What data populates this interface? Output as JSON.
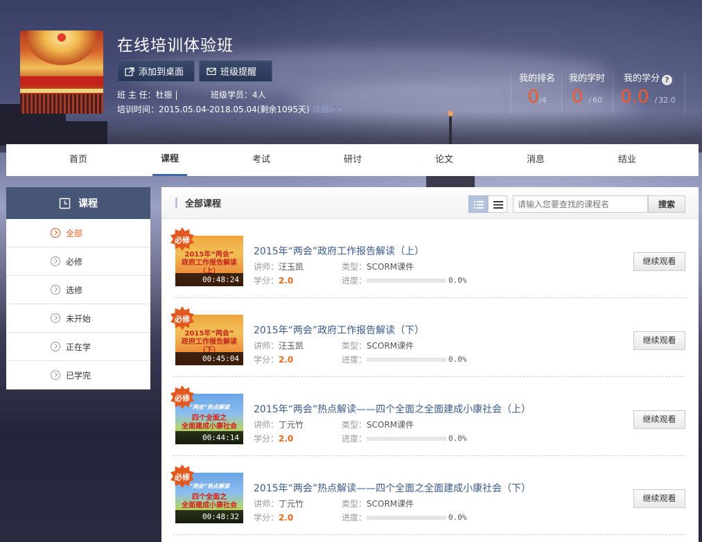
{
  "header": {
    "title": "在线培训体验班",
    "add_desktop_label": "添加到桌面",
    "reminder_label": "班级提醒",
    "teacher_line": "班 主 任：杜振 |",
    "members_line": "班级学员：4人",
    "time_line": "培训时间：2015.05.04-2018.05.04(剩余1095天)",
    "details_link": "详细>>"
  },
  "stats": {
    "rank": {
      "label": "我的排名",
      "value": "0",
      "total": "/4"
    },
    "hours": {
      "label": "我的学时",
      "value": "0",
      "sep": "/",
      "total": "60"
    },
    "credits": {
      "label": "我的学分",
      "value": "0.0",
      "sep": "/",
      "total": "32.0",
      "help": "?"
    }
  },
  "nav": {
    "items": [
      "首页",
      "课程",
      "考试",
      "研讨",
      "论文",
      "消息",
      "结业"
    ],
    "active": "课程"
  },
  "sidebar": {
    "title": "课程",
    "items": [
      {
        "label": "全部",
        "active": true
      },
      {
        "label": "必修",
        "active": false
      },
      {
        "label": "选修",
        "active": false
      },
      {
        "label": "未开始",
        "active": false
      },
      {
        "label": "正在学",
        "active": false
      },
      {
        "label": "已学完",
        "active": false
      }
    ]
  },
  "main": {
    "title": "全部课程",
    "search_placeholder": "请输入您要查找的课程名",
    "search_button": "搜索",
    "labels": {
      "lecturer": "讲师：",
      "type": "类型：",
      "credit": "学分：",
      "progress": "进度："
    },
    "courses": [
      {
        "badge": "必修",
        "thumb_style": "orange",
        "thumb_lines": [
          "2015年“两会”",
          "政府工作报告解读",
          "（上）"
        ],
        "duration": "00:48:24",
        "title": "2015年“两会”政府工作报告解读（上）",
        "lecturer": "汪玉凯",
        "type": "SCORM课件",
        "credit": "2.0",
        "progress": 0.0,
        "progress_text": "0.0%",
        "button": "继续观看"
      },
      {
        "badge": "必修",
        "thumb_style": "orange",
        "thumb_lines": [
          "2015年“两会”",
          "政府工作报告解读",
          "（下）"
        ],
        "duration": "00:45:04",
        "title": "2015年“两会”政府工作报告解读（下）",
        "lecturer": "汪玉凯",
        "type": "SCORM课件",
        "credit": "2.0",
        "progress": 0.0,
        "progress_text": "0.0%",
        "button": "继续观看"
      },
      {
        "badge": "必修",
        "thumb_style": "blue",
        "thumb_lines": [
          "“两会”热点解读",
          "四个全面之",
          "全面建成小康社会"
        ],
        "duration": "00:44:14",
        "title": "2015年“两会”热点解读——四个全面之全面建成小康社会（上）",
        "lecturer": "丁元竹",
        "type": "SCORM课件",
        "credit": "2.0",
        "progress": 0.0,
        "progress_text": "0.0%",
        "button": "继续观看"
      },
      {
        "badge": "必修",
        "thumb_style": "blue",
        "thumb_lines": [
          "“两会”热点解读",
          "四个全面之",
          "全面建成小康社会"
        ],
        "duration": "00:48:32",
        "title": "2015年“两会”热点解读——四个全面之全面建成小康社会（下）",
        "lecturer": "丁元竹",
        "type": "SCORM课件",
        "credit": "2.0",
        "progress": 0.0,
        "progress_text": "0.0%",
        "button": "继续观看"
      }
    ]
  }
}
